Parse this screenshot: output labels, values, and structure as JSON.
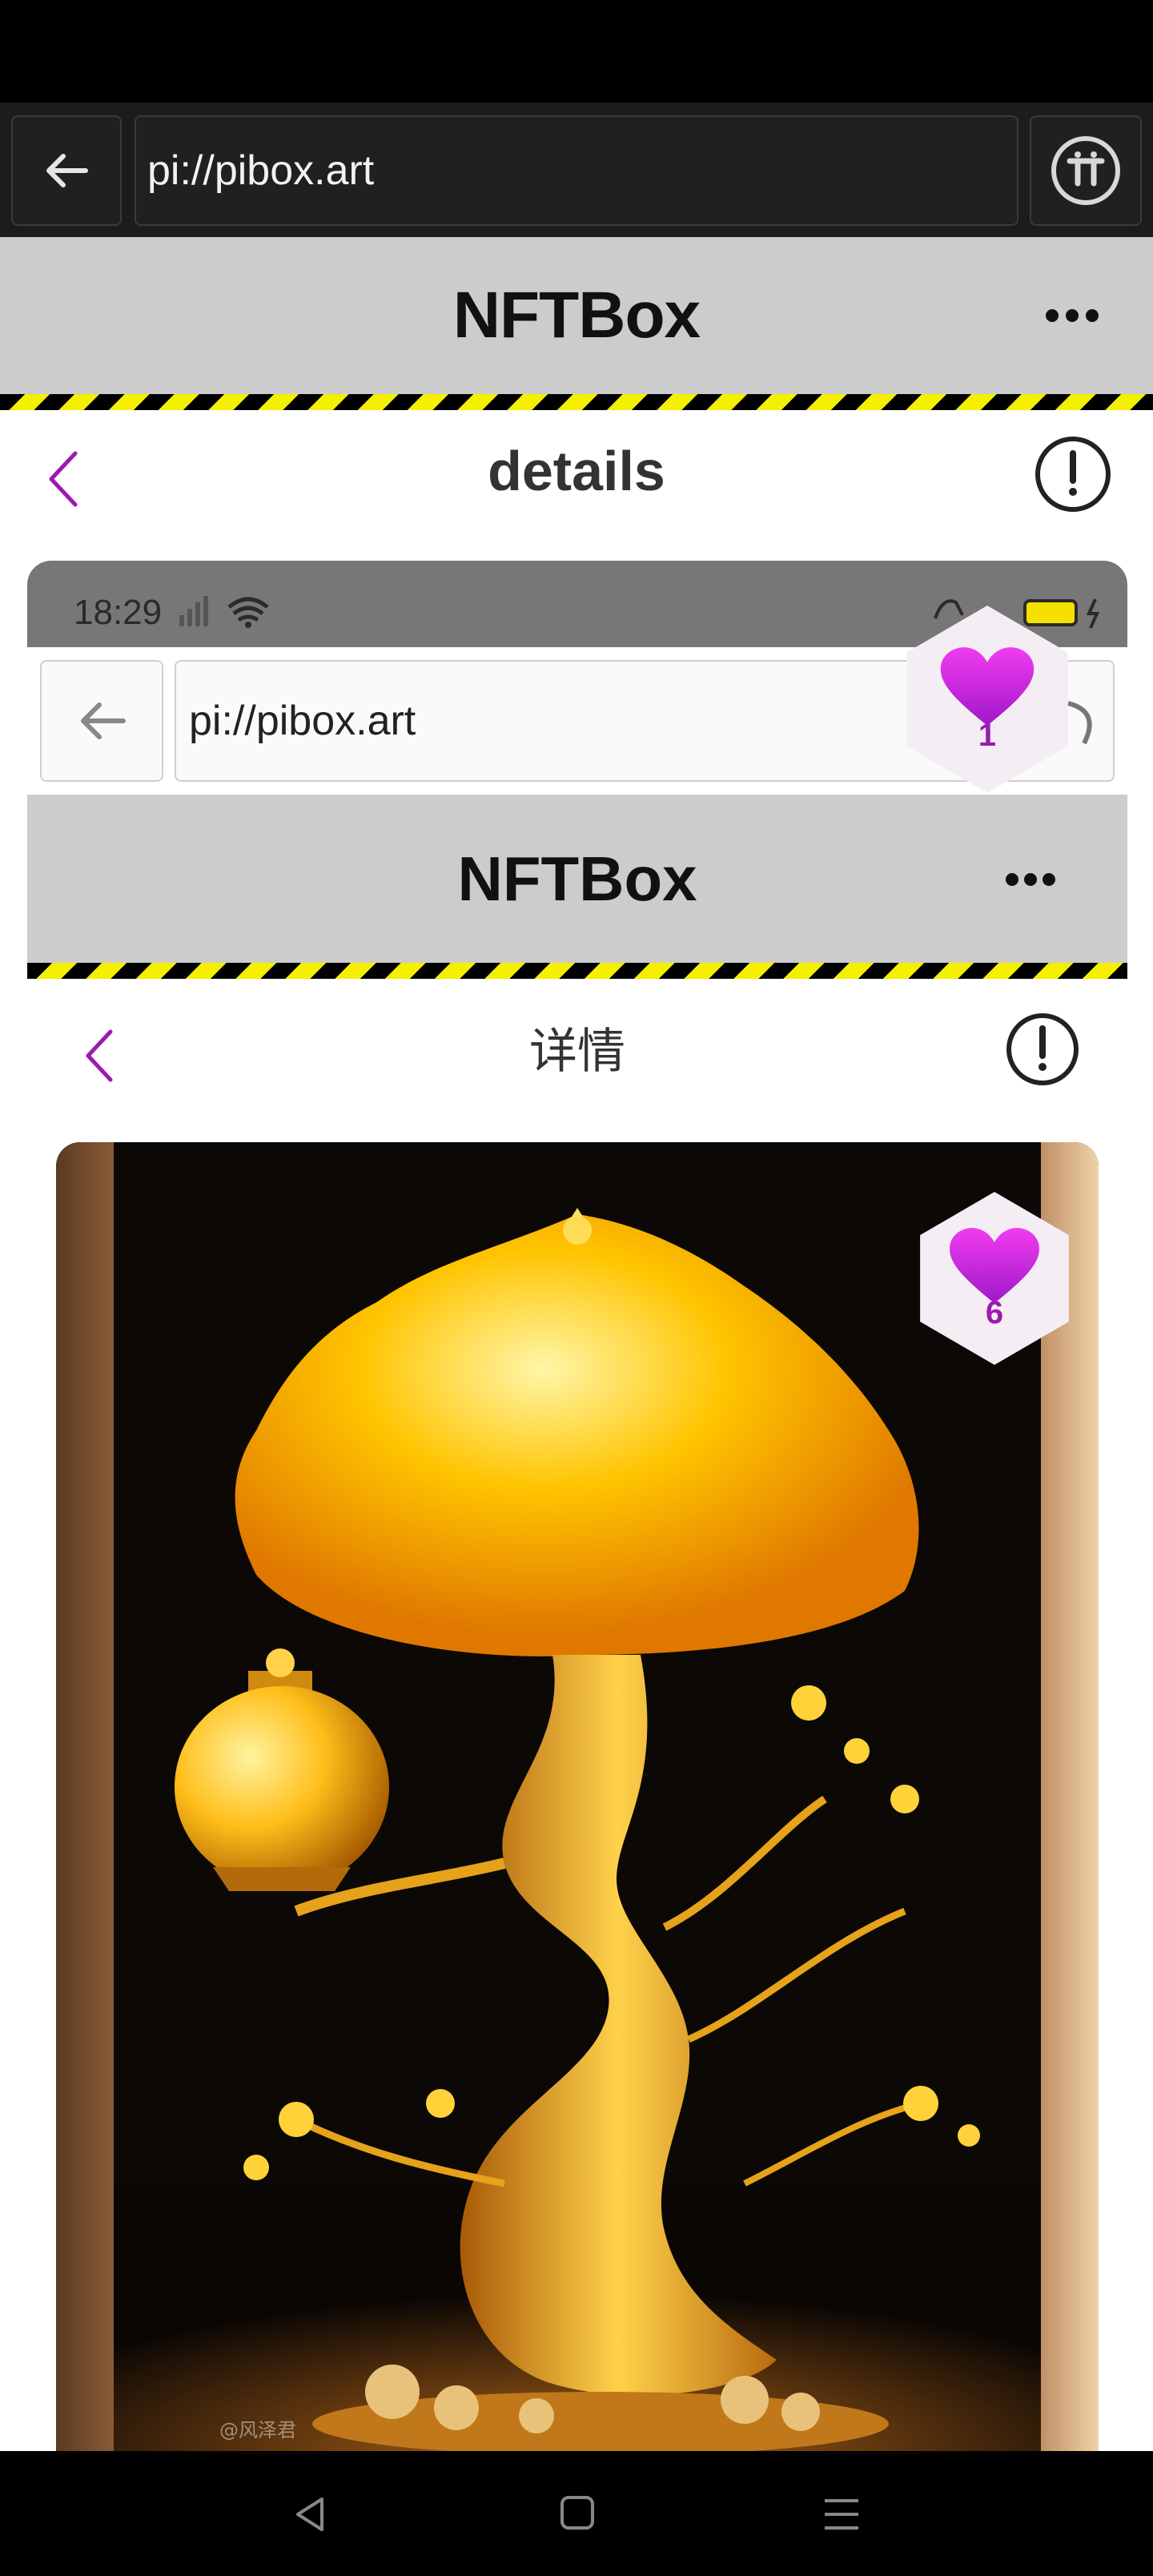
{
  "browser": {
    "url": "pi://pibox.art"
  },
  "app": {
    "title": "NFTBox"
  },
  "page": {
    "title": "details"
  },
  "screenshot": {
    "time": "18:29",
    "browser_url": "pi://pibox.art",
    "app_title": "NFTBox",
    "page_title": "详情",
    "likes": "6",
    "watermark": "@风泽君"
  },
  "likes_overlay": "1",
  "icons": {
    "back": "arrow-left-icon",
    "pi": "pi-logo-icon",
    "more": "more-dots-icon",
    "info": "info-circle-icon",
    "heart": "heart-icon",
    "nav_back": "triangle-back-icon",
    "nav_home": "square-home-icon",
    "nav_menu": "menu-lines-icon"
  },
  "colors": {
    "accent": "#9c1ab0",
    "stripe_yellow": "#f5ef00",
    "header_gray": "#cccccc"
  }
}
